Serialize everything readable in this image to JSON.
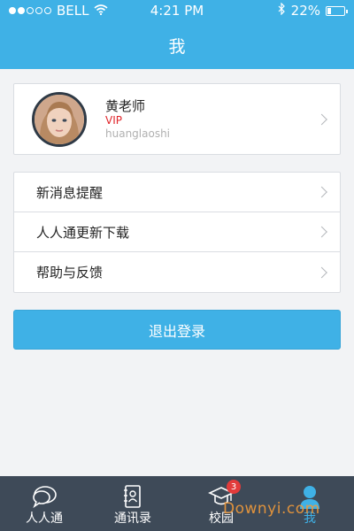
{
  "status_bar": {
    "carrier": "BELL",
    "time": "4:21 PM",
    "battery": "22%",
    "battery_level": 0.22,
    "signal_bars_filled": 2,
    "signal_bars_total": 5,
    "icons": [
      "wifi-icon",
      "bluetooth-icon",
      "battery-icon"
    ]
  },
  "nav": {
    "title": "我"
  },
  "profile": {
    "name": "黄老师",
    "vip": "VIP",
    "username": "huanglaoshi"
  },
  "menu": {
    "items": [
      {
        "label": "新消息提醒"
      },
      {
        "label": "人人通更新下载"
      },
      {
        "label": "帮助与反馈"
      }
    ]
  },
  "logout": {
    "label": "退出登录"
  },
  "tabs": [
    {
      "label": "人人通",
      "icon": "chat-bubble-icon"
    },
    {
      "label": "通讯录",
      "icon": "contacts-book-icon"
    },
    {
      "label": "校园",
      "icon": "school-cap-icon",
      "badge": "3"
    },
    {
      "label": "我",
      "icon": "person-icon",
      "active": true
    }
  ],
  "colors": {
    "accent": "#3fb1e6",
    "tab_bar": "#3e4a58",
    "vip": "#e0262b",
    "badge": "#e23b3b"
  },
  "watermark": "Downyi.com"
}
